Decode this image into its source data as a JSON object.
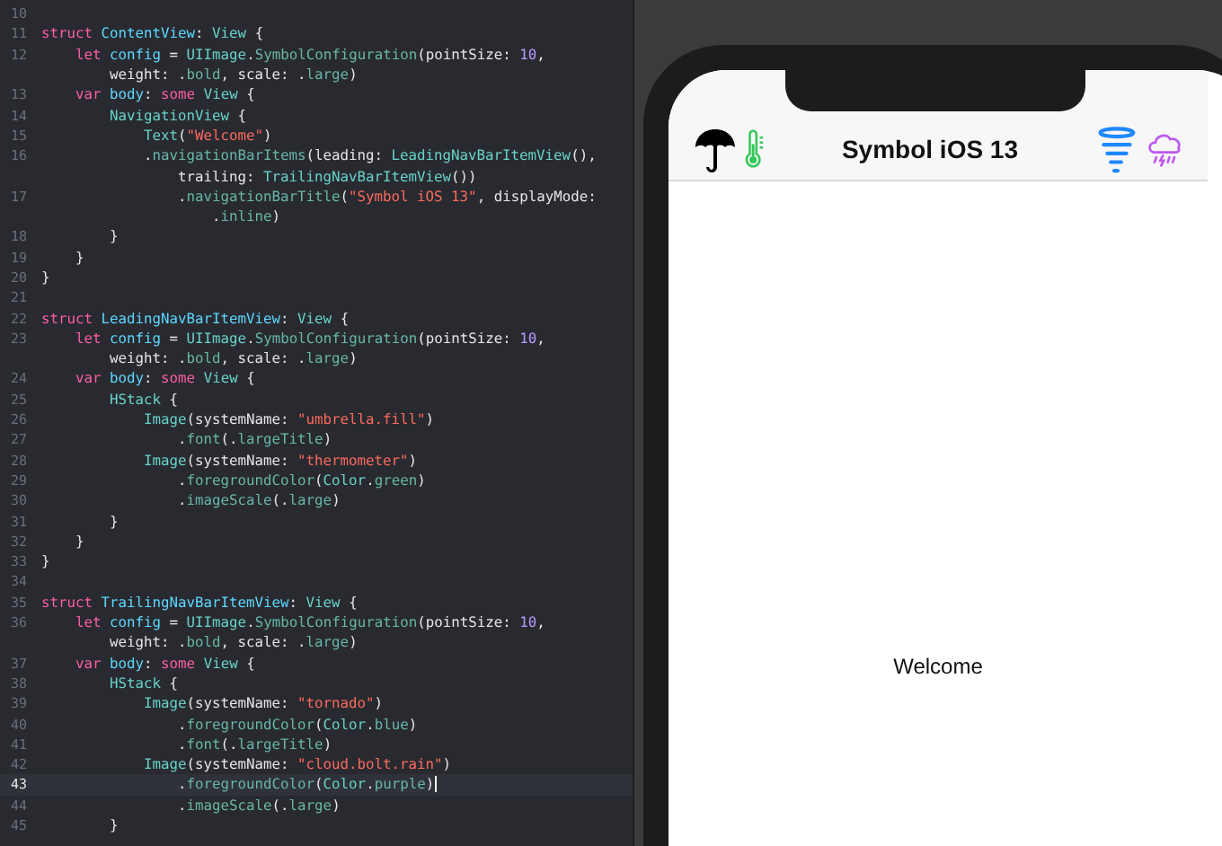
{
  "editor": {
    "lines": [
      {
        "number": "10",
        "selected": false
      },
      {
        "number": "11",
        "selected": false,
        "tokens": [
          {
            "keyword": "struct "
          },
          {
            "declaration": "ContentView"
          },
          {
            "plain": ": "
          },
          {
            "type": "View"
          },
          {
            "plain": " {"
          }
        ]
      },
      {
        "number": "12",
        "selected": false,
        "tokens": [
          {
            "keyword": "    let "
          },
          {
            "declaration": "config"
          },
          {
            "plain": " = "
          },
          {
            "type": "UIImage"
          },
          {
            "plain": "."
          },
          {
            "method": "SymbolConfiguration"
          },
          {
            "plain": "(pointSize: "
          },
          {
            "number": "10"
          },
          {
            "plain": ","
          }
        ],
        "wrap": [
          {
            "plain": "        weight: ."
          },
          {
            "method": "bold"
          },
          {
            "plain": ", scale: ."
          },
          {
            "method": "large"
          },
          {
            "plain": ")"
          }
        ]
      },
      {
        "number": "13",
        "selected": false,
        "tokens": [
          {
            "keyword": "    var "
          },
          {
            "declaration": "body"
          },
          {
            "plain": ": "
          },
          {
            "keyword": "some "
          },
          {
            "type": "View"
          },
          {
            "plain": " {"
          }
        ]
      },
      {
        "number": "14",
        "selected": false,
        "tokens": [
          {
            "type": "        NavigationView"
          },
          {
            "plain": " {"
          }
        ]
      },
      {
        "number": "15",
        "selected": false,
        "tokens": [
          {
            "type": "            Text"
          },
          {
            "plain": "("
          },
          {
            "string": "\"Welcome\""
          },
          {
            "plain": ")"
          }
        ]
      },
      {
        "number": "16",
        "selected": false,
        "tokens": [
          {
            "plain": "            ."
          },
          {
            "method": "navigationBarItems"
          },
          {
            "plain": "(leading: "
          },
          {
            "type": "LeadingNavBarItemView"
          },
          {
            "plain": "(),"
          }
        ],
        "wrap": [
          {
            "plain": "                trailing: "
          },
          {
            "type": "TrailingNavBarItemView"
          },
          {
            "plain": "())"
          }
        ]
      },
      {
        "number": "17",
        "selected": false,
        "tokens": [
          {
            "plain": "                ."
          },
          {
            "method": "navigationBarTitle"
          },
          {
            "plain": "("
          },
          {
            "string": "\"Symbol iOS 13\""
          },
          {
            "plain": ", displayMode:"
          }
        ],
        "wrap": [
          {
            "plain": "                    ."
          },
          {
            "method": "inline"
          },
          {
            "plain": ")"
          }
        ]
      },
      {
        "number": "18",
        "selected": false,
        "tokens": [
          {
            "plain": "        }"
          }
        ]
      },
      {
        "number": "19",
        "selected": false,
        "tokens": [
          {
            "plain": "    }"
          }
        ]
      },
      {
        "number": "20",
        "selected": false,
        "tokens": [
          {
            "plain": "}"
          }
        ]
      },
      {
        "number": "21",
        "selected": false
      },
      {
        "number": "22",
        "selected": false,
        "tokens": [
          {
            "keyword": "struct "
          },
          {
            "declaration": "LeadingNavBarItemView"
          },
          {
            "plain": ": "
          },
          {
            "type": "View"
          },
          {
            "plain": " {"
          }
        ]
      },
      {
        "number": "23",
        "selected": false,
        "tokens": [
          {
            "keyword": "    let "
          },
          {
            "declaration": "config"
          },
          {
            "plain": " = "
          },
          {
            "type": "UIImage"
          },
          {
            "plain": "."
          },
          {
            "method": "SymbolConfiguration"
          },
          {
            "plain": "(pointSize: "
          },
          {
            "number": "10"
          },
          {
            "plain": ","
          }
        ],
        "wrap": [
          {
            "plain": "        weight: ."
          },
          {
            "method": "bold"
          },
          {
            "plain": ", scale: ."
          },
          {
            "method": "large"
          },
          {
            "plain": ")"
          }
        ]
      },
      {
        "number": "24",
        "selected": false,
        "tokens": [
          {
            "keyword": "    var "
          },
          {
            "declaration": "body"
          },
          {
            "plain": ": "
          },
          {
            "keyword": "some "
          },
          {
            "type": "View"
          },
          {
            "plain": " {"
          }
        ]
      },
      {
        "number": "25",
        "selected": false,
        "tokens": [
          {
            "type": "        HStack"
          },
          {
            "plain": " {"
          }
        ]
      },
      {
        "number": "26",
        "selected": false,
        "tokens": [
          {
            "type": "            Image"
          },
          {
            "plain": "(systemName: "
          },
          {
            "string": "\"umbrella.fill\""
          },
          {
            "plain": ")"
          }
        ]
      },
      {
        "number": "27",
        "selected": false,
        "tokens": [
          {
            "plain": "                ."
          },
          {
            "method": "font"
          },
          {
            "plain": "(."
          },
          {
            "method": "largeTitle"
          },
          {
            "plain": ")"
          }
        ]
      },
      {
        "number": "28",
        "selected": false,
        "tokens": [
          {
            "type": "            Image"
          },
          {
            "plain": "(systemName: "
          },
          {
            "string": "\"thermometer\""
          },
          {
            "plain": ")"
          }
        ]
      },
      {
        "number": "29",
        "selected": false,
        "tokens": [
          {
            "plain": "                ."
          },
          {
            "method": "foregroundColor"
          },
          {
            "plain": "("
          },
          {
            "type": "Color"
          },
          {
            "plain": "."
          },
          {
            "method": "green"
          },
          {
            "plain": ")"
          }
        ]
      },
      {
        "number": "30",
        "selected": false,
        "tokens": [
          {
            "plain": "                ."
          },
          {
            "method": "imageScale"
          },
          {
            "plain": "(."
          },
          {
            "method": "large"
          },
          {
            "plain": ")"
          }
        ]
      },
      {
        "number": "31",
        "selected": false,
        "tokens": [
          {
            "plain": "        }"
          }
        ]
      },
      {
        "number": "32",
        "selected": false,
        "tokens": [
          {
            "plain": "    }"
          }
        ]
      },
      {
        "number": "33",
        "selected": false,
        "tokens": [
          {
            "plain": "}"
          }
        ]
      },
      {
        "number": "34",
        "selected": false
      },
      {
        "number": "35",
        "selected": false,
        "tokens": [
          {
            "keyword": "struct "
          },
          {
            "declaration": "TrailingNavBarItemView"
          },
          {
            "plain": ": "
          },
          {
            "type": "View"
          },
          {
            "plain": " {"
          }
        ]
      },
      {
        "number": "36",
        "selected": false,
        "tokens": [
          {
            "keyword": "    let "
          },
          {
            "declaration": "config"
          },
          {
            "plain": " = "
          },
          {
            "type": "UIImage"
          },
          {
            "plain": "."
          },
          {
            "method": "SymbolConfiguration"
          },
          {
            "plain": "(pointSize: "
          },
          {
            "number": "10"
          },
          {
            "plain": ","
          }
        ],
        "wrap": [
          {
            "plain": "        weight: ."
          },
          {
            "method": "bold"
          },
          {
            "plain": ", scale: ."
          },
          {
            "method": "large"
          },
          {
            "plain": ")"
          }
        ]
      },
      {
        "number": "37",
        "selected": false,
        "tokens": [
          {
            "keyword": "    var "
          },
          {
            "declaration": "body"
          },
          {
            "plain": ": "
          },
          {
            "keyword": "some "
          },
          {
            "type": "View"
          },
          {
            "plain": " {"
          }
        ]
      },
      {
        "number": "38",
        "selected": false,
        "tokens": [
          {
            "type": "        HStack"
          },
          {
            "plain": " {"
          }
        ]
      },
      {
        "number": "39",
        "selected": false,
        "tokens": [
          {
            "type": "            Image"
          },
          {
            "plain": "(systemName: "
          },
          {
            "string": "\"tornado\""
          },
          {
            "plain": ")"
          }
        ]
      },
      {
        "number": "40",
        "selected": false,
        "tokens": [
          {
            "plain": "                ."
          },
          {
            "method": "foregroundColor"
          },
          {
            "plain": "("
          },
          {
            "type": "Color"
          },
          {
            "plain": "."
          },
          {
            "method": "blue"
          },
          {
            "plain": ")"
          }
        ]
      },
      {
        "number": "41",
        "selected": false,
        "tokens": [
          {
            "plain": "                ."
          },
          {
            "method": "font"
          },
          {
            "plain": "(."
          },
          {
            "method": "largeTitle"
          },
          {
            "plain": ")"
          }
        ]
      },
      {
        "number": "42",
        "selected": false,
        "tokens": [
          {
            "type": "            Image"
          },
          {
            "plain": "(systemName: "
          },
          {
            "string": "\"cloud.bolt.rain\""
          },
          {
            "plain": ")"
          }
        ]
      },
      {
        "number": "43",
        "selected": true,
        "tokens": [
          {
            "plain": "                ."
          },
          {
            "method": "foregroundColor"
          },
          {
            "plain": "("
          },
          {
            "type": "Color"
          },
          {
            "plain": "."
          },
          {
            "method": "purple"
          },
          {
            "plain": ")"
          }
        ]
      },
      {
        "number": "44",
        "selected": false,
        "tokens": [
          {
            "plain": "                ."
          },
          {
            "method": "imageScale"
          },
          {
            "plain": "(."
          },
          {
            "method": "large"
          },
          {
            "plain": ")"
          }
        ]
      },
      {
        "number": "45",
        "selected": false,
        "tokens": [
          {
            "plain": "        }"
          }
        ]
      }
    ]
  },
  "preview": {
    "nav_title": "Symbol iOS 13",
    "content_text": "Welcome"
  }
}
